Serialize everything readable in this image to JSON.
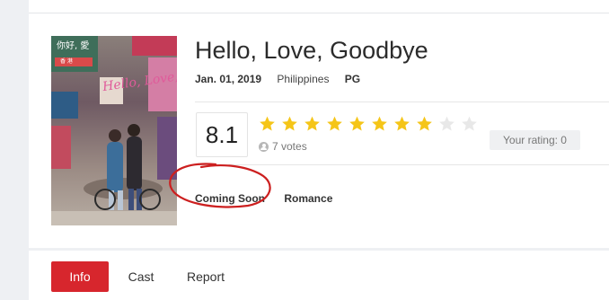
{
  "movie": {
    "title": "Hello, Love, Goodbye",
    "release_date": "Jan. 01, 2019",
    "country": "Philippines",
    "rating_label": "PG",
    "poster": {
      "title_text": "Hello, Love, Goodbye",
      "sign_text": "你好, 愛",
      "sign_subtext": "香 港"
    }
  },
  "rating": {
    "score": "8.1",
    "votes": "7 votes",
    "stars_total": 10,
    "stars_filled": 8,
    "star_color": "#f5c518",
    "star_empty_color": "#e8e8e8",
    "your_rating": "Your rating: 0"
  },
  "genres": [
    "Coming Soon",
    "Romance"
  ],
  "tabs": [
    {
      "label": "Info",
      "active": true
    },
    {
      "label": "Cast",
      "active": false
    },
    {
      "label": "Report",
      "active": false
    }
  ],
  "colors": {
    "accent": "#d7262d",
    "annotation": "#cc1f1f"
  }
}
